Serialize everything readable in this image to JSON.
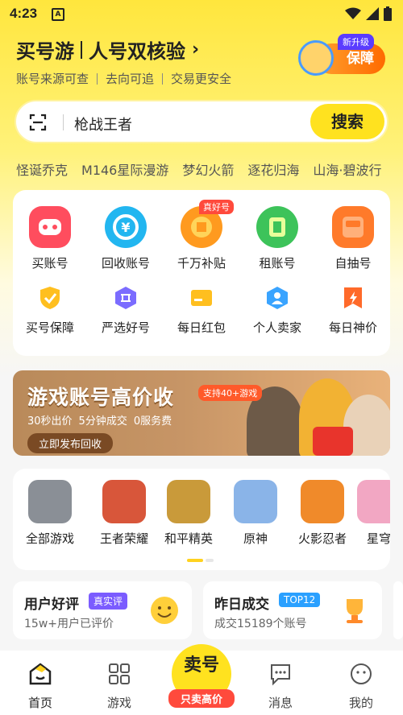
{
  "status": {
    "time": "4:23",
    "notif": "A"
  },
  "header": {
    "title_a": "买号游",
    "title_b": "人号双核验",
    "arrow": "›",
    "sub": [
      "账号来源可查",
      "去向可追",
      "交易更安全"
    ],
    "badge_tag": "新升级",
    "badge_label": "保障"
  },
  "search": {
    "query": "枪战王者",
    "button": "搜索"
  },
  "hot": [
    "怪诞乔克",
    "M146星际漫游",
    "梦幻火箭",
    "逐花归海",
    "山海·碧波行"
  ],
  "main_services": [
    {
      "label": "买账号",
      "icon": "gamepad-icon",
      "color": "#ff4d5e"
    },
    {
      "label": "回收账号",
      "icon": "yen-recycle-icon",
      "color": "#22b6f0"
    },
    {
      "label": "千万补贴",
      "icon": "subsidy-icon",
      "color": "#ff9a1f",
      "tag": "真好号"
    },
    {
      "label": "租账号",
      "icon": "rent-icon",
      "color": "#3dc35a"
    },
    {
      "label": "自抽号",
      "icon": "draw-box-icon",
      "color": "#ff7a2a"
    }
  ],
  "sub_services": [
    {
      "label": "买号保障",
      "icon": "shield-check-icon",
      "color": "#ffbf1f"
    },
    {
      "label": "严选好号",
      "icon": "select-icon",
      "color": "#7b6cff"
    },
    {
      "label": "每日红包",
      "icon": "red-envelope-icon",
      "color": "#ffbf1f"
    },
    {
      "label": "个人卖家",
      "icon": "person-hex-icon",
      "color": "#3aa4ff"
    },
    {
      "label": "每日神价",
      "icon": "lightning-bookmark-icon",
      "color": "#ff6a2a"
    }
  ],
  "banner": {
    "title": "游戏账号高价收",
    "tag": "支持40+游戏",
    "points": [
      "30秒出价",
      "5分钟成交",
      "0服务费"
    ],
    "cta": "立即发布回收"
  },
  "games": [
    {
      "label": "全部游戏",
      "color": "#8a8f96"
    },
    {
      "label": "王者荣耀",
      "color": "#d8563a"
    },
    {
      "label": "和平精英",
      "color": "#c99a3a"
    },
    {
      "label": "原神",
      "color": "#8ab4e8"
    },
    {
      "label": "火影忍者",
      "color": "#f08a2a"
    },
    {
      "label": "星穹",
      "color": "#f2a7c3"
    }
  ],
  "info": [
    {
      "title": "用户好评",
      "chip": "真实评",
      "chip_color": "#7b5cff",
      "sub": "15w+用户已评价"
    },
    {
      "title": "昨日成交",
      "chip": "TOP12",
      "chip_color": "#2aa0ff",
      "sub": "成交15189个账号"
    }
  ],
  "tabs": [
    {
      "label": "首页",
      "icon": "home-icon",
      "active": true
    },
    {
      "label": "游戏",
      "icon": "grid-icon"
    },
    {
      "label": "消息",
      "icon": "message-icon"
    },
    {
      "label": "我的",
      "icon": "profile-icon"
    }
  ],
  "sell": {
    "text": "卖号",
    "label": "只卖高价"
  }
}
